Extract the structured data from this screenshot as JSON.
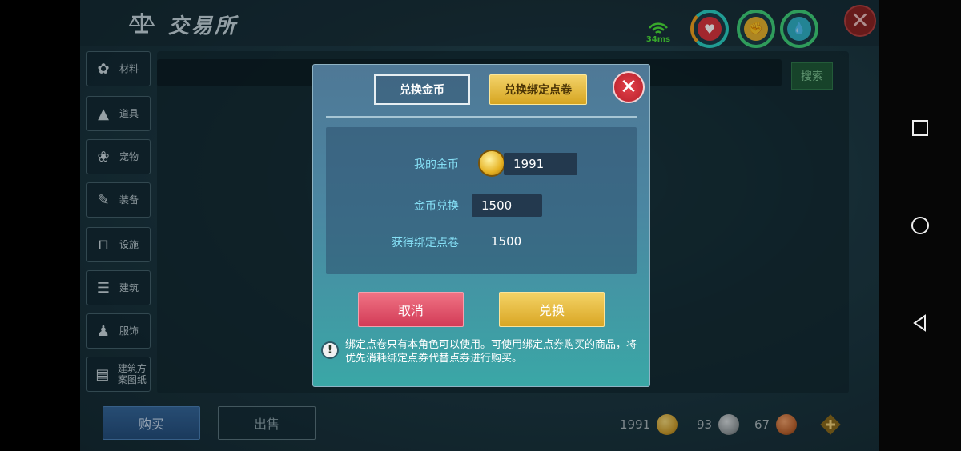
{
  "header": {
    "title": "交易所"
  },
  "network": {
    "ping": "34ms"
  },
  "sidebar": {
    "items": [
      {
        "label": "材料",
        "icon": "material-icon"
      },
      {
        "label": "道具",
        "icon": "item-icon"
      },
      {
        "label": "宠物",
        "icon": "pet-paw-icon"
      },
      {
        "label": "装备",
        "icon": "equipment-icon"
      },
      {
        "label": "设施",
        "icon": "facility-icon"
      },
      {
        "label": "建筑",
        "icon": "building-icon"
      },
      {
        "label": "服饰",
        "icon": "clothing-icon"
      },
      {
        "label": "建筑方案图纸",
        "icon": "blueprint-icon"
      }
    ]
  },
  "search": {
    "button_label": "搜索"
  },
  "bottom": {
    "buy_label": "购买",
    "sell_label": "出售",
    "gold_amount": "1991",
    "silver_amount": "93",
    "bronze_amount": "67"
  },
  "dialog": {
    "tab_gold": "兑换金币",
    "tab_bound": "兑换绑定点卷",
    "my_gold_label": "我的金币",
    "my_gold_value": "1991",
    "exchange_label": "金币兑换",
    "exchange_value": "1500",
    "receive_label": "获得绑定点卷",
    "receive_value": "1500",
    "cancel_label": "取消",
    "confirm_label": "兑换",
    "notice": "绑定点卷只有本角色可以使用。可使用绑定点券购买的商品，将优先消耗绑定点券代替点券进行购买。"
  },
  "colors": {
    "accent_gold": "#d9a624",
    "cancel_red": "#d23b57",
    "status_green": "#3fd17a"
  }
}
